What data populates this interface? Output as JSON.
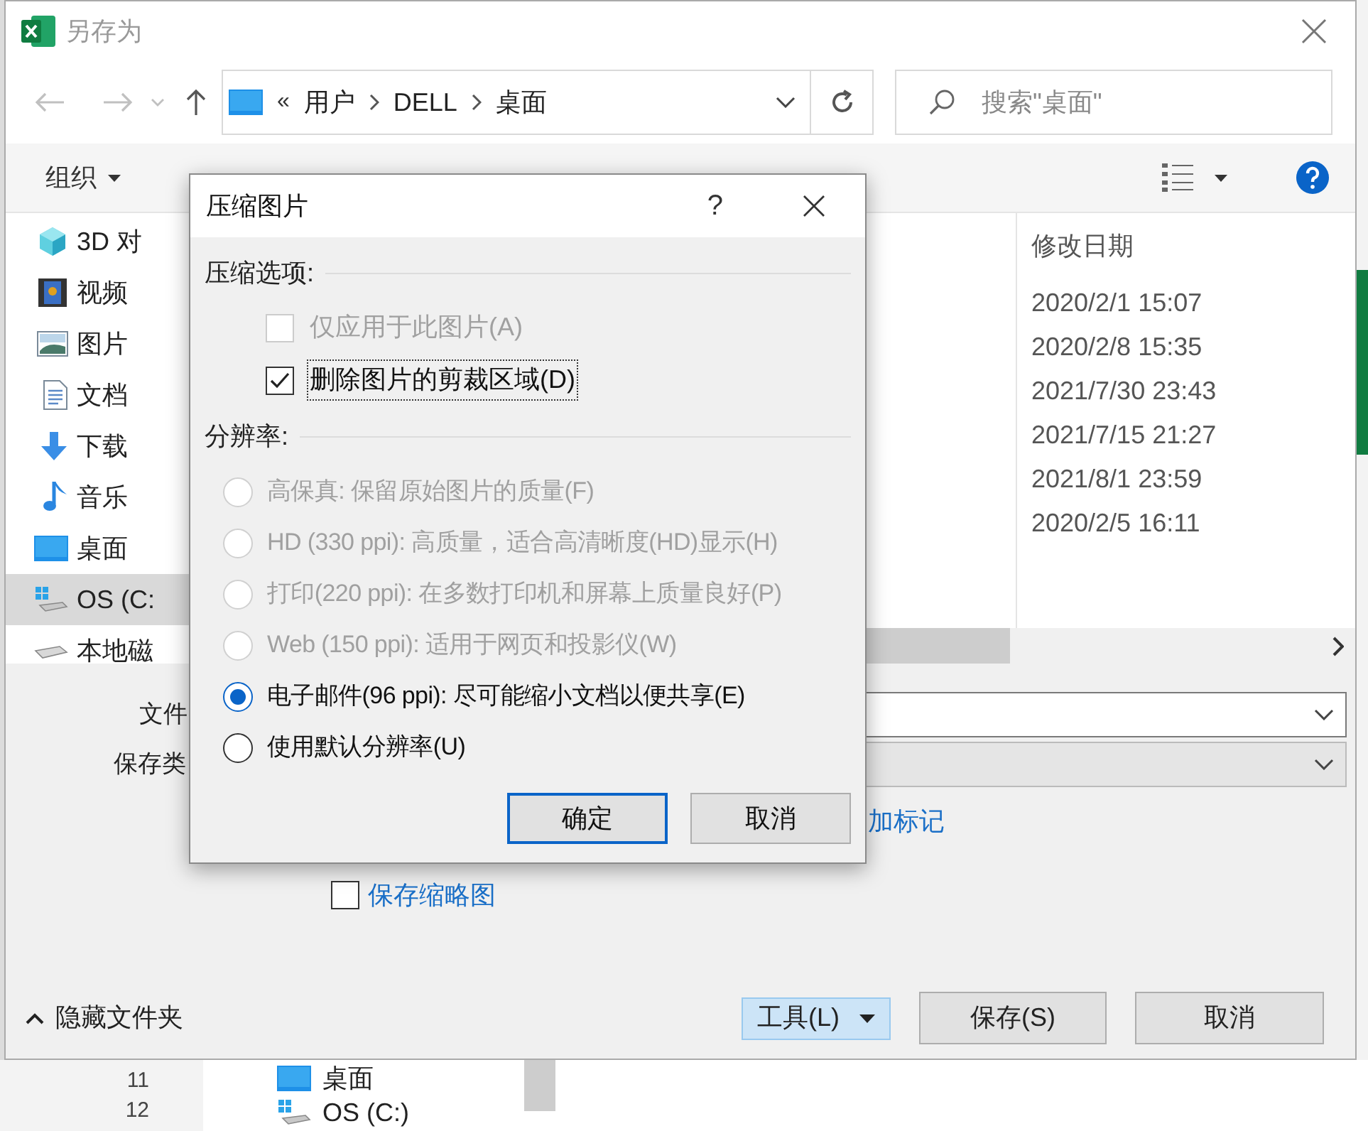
{
  "window": {
    "title": "另存为"
  },
  "nav": {
    "prefix": "«",
    "path": [
      "用户",
      "DELL",
      "桌面"
    ],
    "search_placeholder": "搜索\"桌面\""
  },
  "toolbar": {
    "organize": "组织"
  },
  "sidebar": {
    "items": [
      {
        "label": "3D 对",
        "kind": "cube",
        "selected": false
      },
      {
        "label": "视频",
        "kind": "video",
        "selected": false
      },
      {
        "label": "图片",
        "kind": "picture",
        "selected": false
      },
      {
        "label": "文档",
        "kind": "document",
        "selected": false
      },
      {
        "label": "下载",
        "kind": "download",
        "selected": false
      },
      {
        "label": "音乐",
        "kind": "music",
        "selected": false
      },
      {
        "label": "桌面",
        "kind": "desktop",
        "selected": false
      },
      {
        "label": "OS (C:",
        "kind": "drive-os",
        "selected": true
      },
      {
        "label": "本地磁",
        "kind": "drive",
        "selected": false
      }
    ]
  },
  "file_list": {
    "column": "修改日期",
    "dates": [
      "2020/2/1 15:07",
      "2020/2/8 15:35",
      "2021/7/30 23:43",
      "2021/7/15 21:27",
      "2021/8/1 23:59",
      "2020/2/5 16:11"
    ]
  },
  "form": {
    "filename_label": "文件",
    "type_label": "保存类",
    "tags_link": "加标记",
    "thumbnail": {
      "label": "保存缩略图",
      "checked": false
    }
  },
  "footer": {
    "hide_folders": "隐藏文件夹",
    "tools": "工具(L)",
    "save": "保存(S)",
    "cancel": "取消"
  },
  "dialog": {
    "title": "压缩图片",
    "help": "?",
    "options_heading": "压缩选项:",
    "options": [
      {
        "label": "仅应用于此图片(A)",
        "checked": false,
        "disabled": true
      },
      {
        "label": "删除图片的剪裁区域(D)",
        "checked": true,
        "disabled": false
      }
    ],
    "resolution_heading": "分辨率:",
    "resolutions": [
      {
        "label": "高保真: 保留原始图片的质量(F)",
        "selected": false,
        "disabled": true
      },
      {
        "label": "HD (330 ppi): 高质量，适合高清晰度(HD)显示(H)",
        "selected": false,
        "disabled": true
      },
      {
        "label": "打印(220 ppi): 在多数打印机和屏幕上质量良好(P)",
        "selected": false,
        "disabled": true
      },
      {
        "label": "Web (150 ppi): 适用于网页和投影仪(W)",
        "selected": false,
        "disabled": true
      },
      {
        "label": "电子邮件(96 ppi): 尽可能缩小文档以便共享(E)",
        "selected": true,
        "disabled": false
      },
      {
        "label": "使用默认分辨率(U)",
        "selected": false,
        "disabled": false
      }
    ],
    "ok": "确定",
    "cancel": "取消"
  },
  "background": {
    "row_numbers": [
      "11",
      "12"
    ],
    "nav_items": [
      "桌面",
      "OS (C:)"
    ]
  }
}
